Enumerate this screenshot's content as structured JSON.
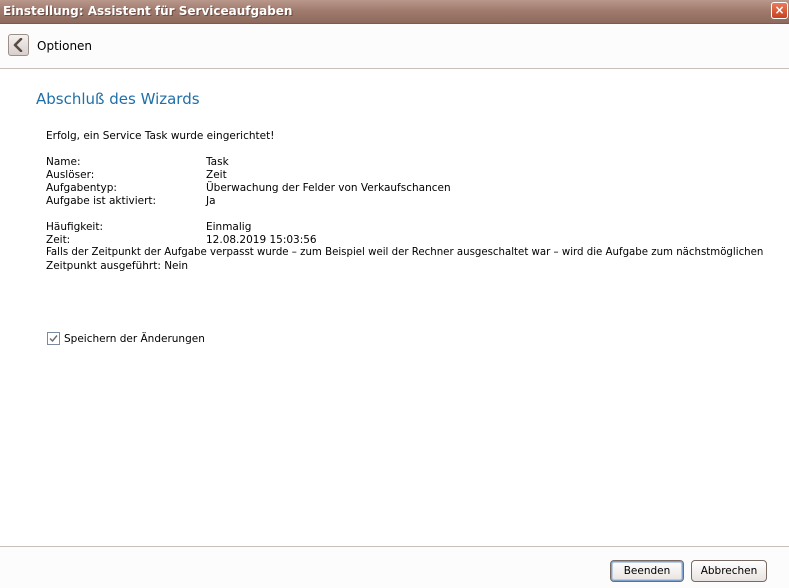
{
  "window": {
    "title": "Einstellung: Assistent für Serviceaufgaben",
    "close_glyph": "×"
  },
  "nav": {
    "back_icon": "chevron-left-icon",
    "label": "Optionen"
  },
  "main": {
    "heading": "Abschluß des Wizards",
    "success_message": "Erfolg, ein Service Task wurde eingerichtet!",
    "summary": {
      "name_label": "Name:",
      "name_value": "Task",
      "trigger_label": "Auslöser:",
      "trigger_value": "Zeit",
      "type_label": "Aufgabentyp:",
      "type_value": "Überwachung der Felder von Verkaufschancen",
      "active_label": "Aufgabe ist aktiviert:",
      "active_value": "Ja",
      "frequency_label": "Häufigkeit:",
      "frequency_value": "Einmalig",
      "time_label": "Zeit:",
      "time_value": "12.08.2019 15:03:56",
      "missed_line1": "Falls der Zeitpunkt der Aufgabe verpasst wurde – zum Beispiel weil der Rechner ausgeschaltet war – wird die Aufgabe zum nächstmöglichen",
      "missed_line2": "Zeitpunkt ausgeführt: Nein"
    },
    "save_changes": {
      "label": "Speichern der Änderungen",
      "checked": true
    }
  },
  "footer": {
    "finish_label": "Beenden",
    "cancel_label": "Abbrechen"
  },
  "colors": {
    "titlebar": "#a07b6e",
    "heading": "#1f6fa8",
    "close": "#c8401e"
  }
}
